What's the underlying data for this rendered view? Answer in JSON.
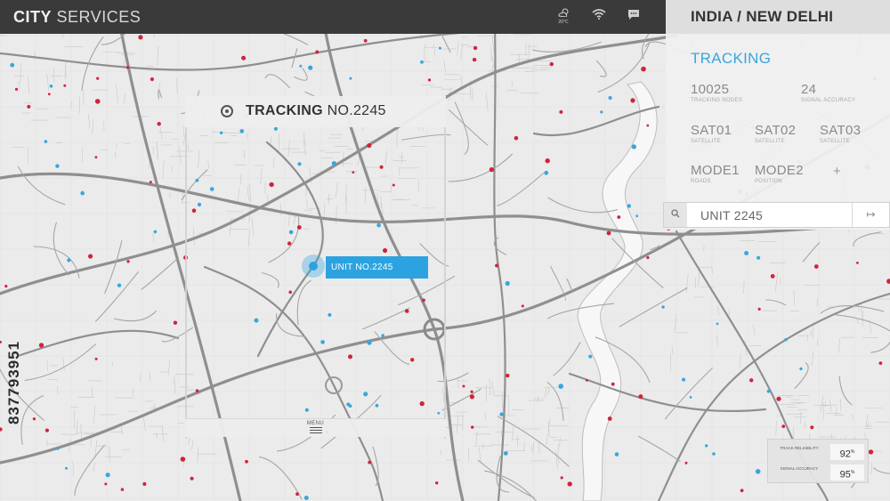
{
  "header": {
    "title_bold": "CITY",
    "title_light": "SERVICES",
    "weather_icon": "cloud-sun-icon",
    "weather_temp": "20°C",
    "wifi_icon": "wifi-icon",
    "chat_icon": "chat-icon"
  },
  "location": {
    "title": "INDIA / NEW DELHI"
  },
  "panel": {
    "section_title": "TRACKING",
    "stats": [
      {
        "value": "10025",
        "label": "TRACKING NODES"
      },
      {
        "value": "24",
        "label": "SIGNAL ACCURACY"
      },
      {
        "value": "SAT01",
        "label": "SATELLITE"
      },
      {
        "value": "SAT02",
        "label": "SATELLITE"
      },
      {
        "value": "SAT03",
        "label": "SATELLITE"
      },
      {
        "value": "MODE1",
        "label": "ROADS"
      },
      {
        "value": "MODE2",
        "label": "POSITION"
      }
    ],
    "add_label": "+"
  },
  "search": {
    "value": "UNIT 2245",
    "icon": "search-icon",
    "go_icon": "arrow-right-icon",
    "go_label": "↦"
  },
  "tracking_popup": {
    "title_bold": "TRACKING",
    "title_light": "NO.2245",
    "menu_label": "MENU",
    "unit_label": "UNIT NO.2245"
  },
  "watermark": {
    "stock_id": "837793951"
  },
  "reliability": [
    {
      "label": "TRACK RELIABILITY",
      "value": "92",
      "unit": "%"
    },
    {
      "label": "SIGNAL ACCURACY",
      "value": "95",
      "unit": "%"
    }
  ],
  "colors": {
    "topbar": "#3a3a3a",
    "accent_blue": "#2ca3e0",
    "marker_red": "#d0243c",
    "marker_blue": "#38a6dd",
    "road": "#8f8f8f",
    "map_bg": "#e9e9e9"
  }
}
